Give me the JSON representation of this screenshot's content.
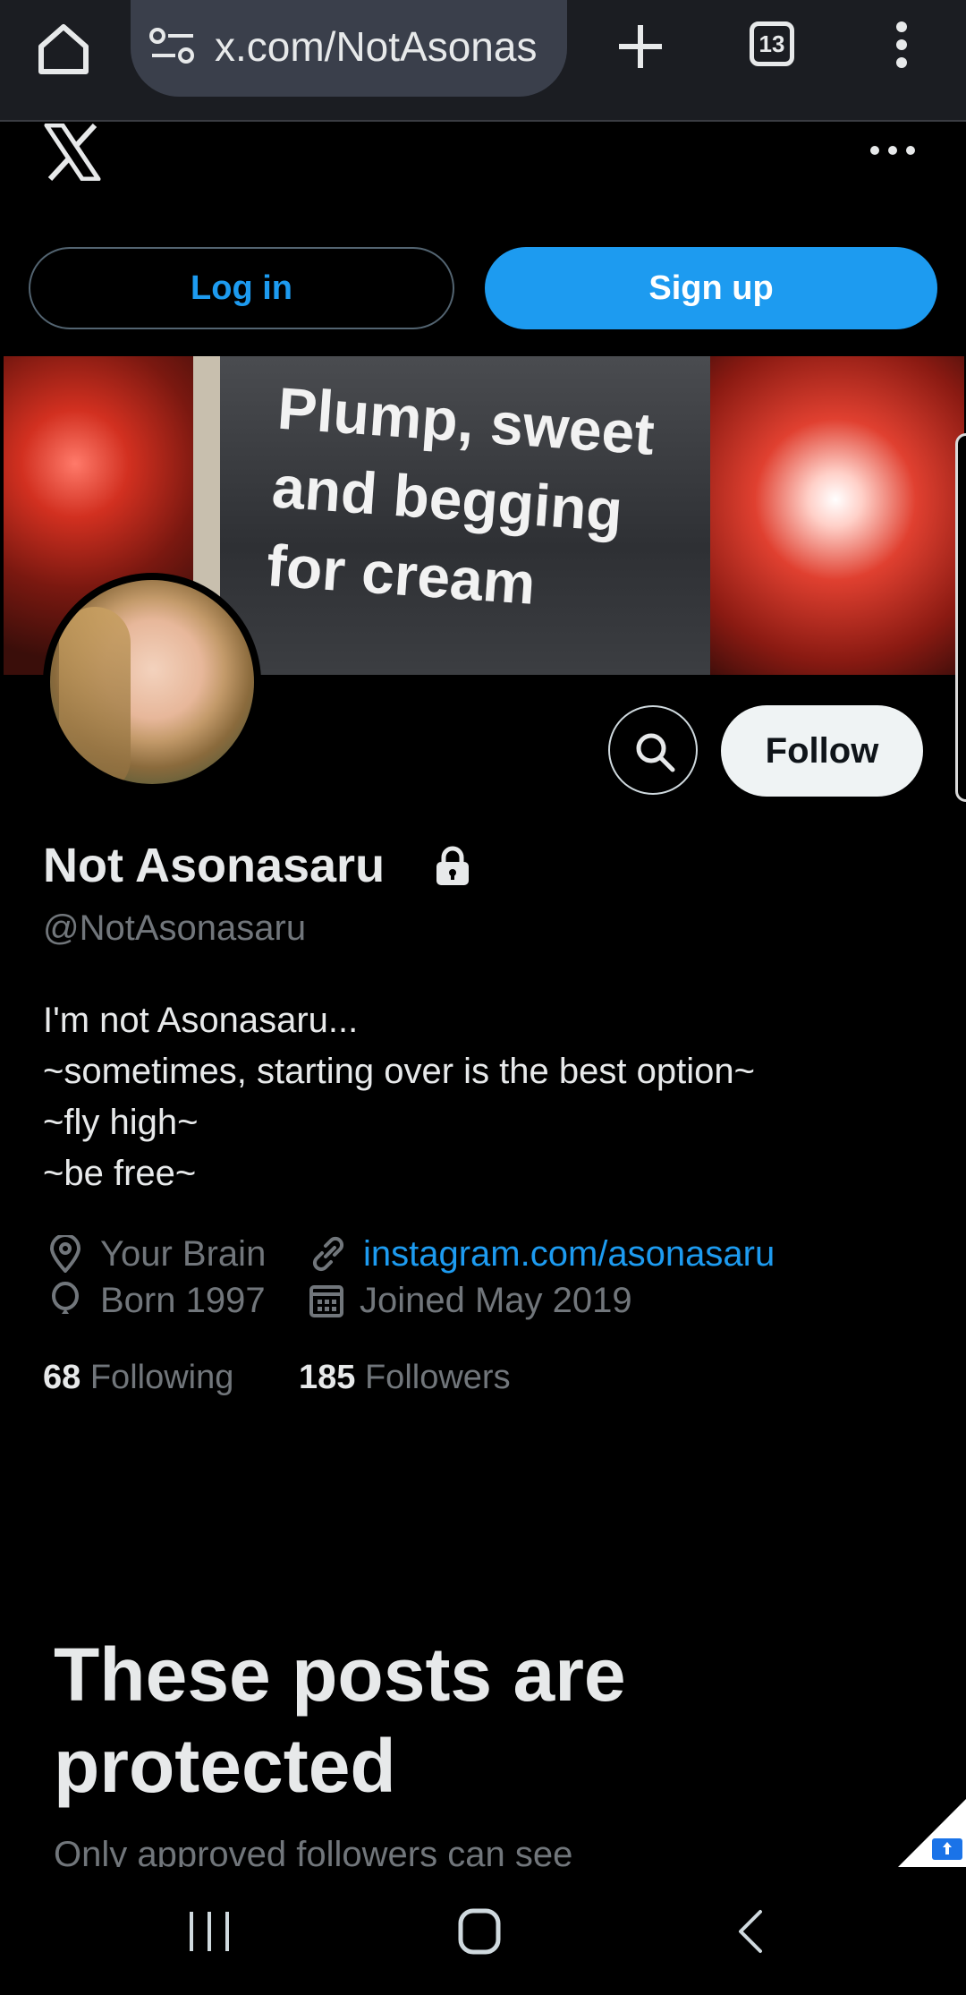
{
  "browser": {
    "url": "x.com/NotAsonas",
    "tab_count": "13"
  },
  "auth": {
    "login_label": "Log in",
    "signup_label": "Sign up"
  },
  "banner": {
    "text": "Plump, sweet\nand begging\nfor cream"
  },
  "profile": {
    "display_name": "Not Asonasaru",
    "handle": "@NotAsonasaru",
    "follow_label": "Follow",
    "bio_lines": [
      "I'm not Asonasaru...",
      "~sometimes, starting over is the best option~",
      "~fly high~",
      "~be free~"
    ],
    "location": "Your Brain",
    "website": "instagram.com/asonasaru",
    "birth": "Born 1997",
    "joined": "Joined May 2019",
    "following_count": "68",
    "following_label": "Following",
    "followers_count": "185",
    "followers_label": "Followers"
  },
  "protected": {
    "title": "These posts are protected",
    "subtitle": "Only approved followers can see"
  },
  "colors": {
    "accent": "#1d9bf0",
    "background": "#000000",
    "secondary_text": "#71767b"
  }
}
